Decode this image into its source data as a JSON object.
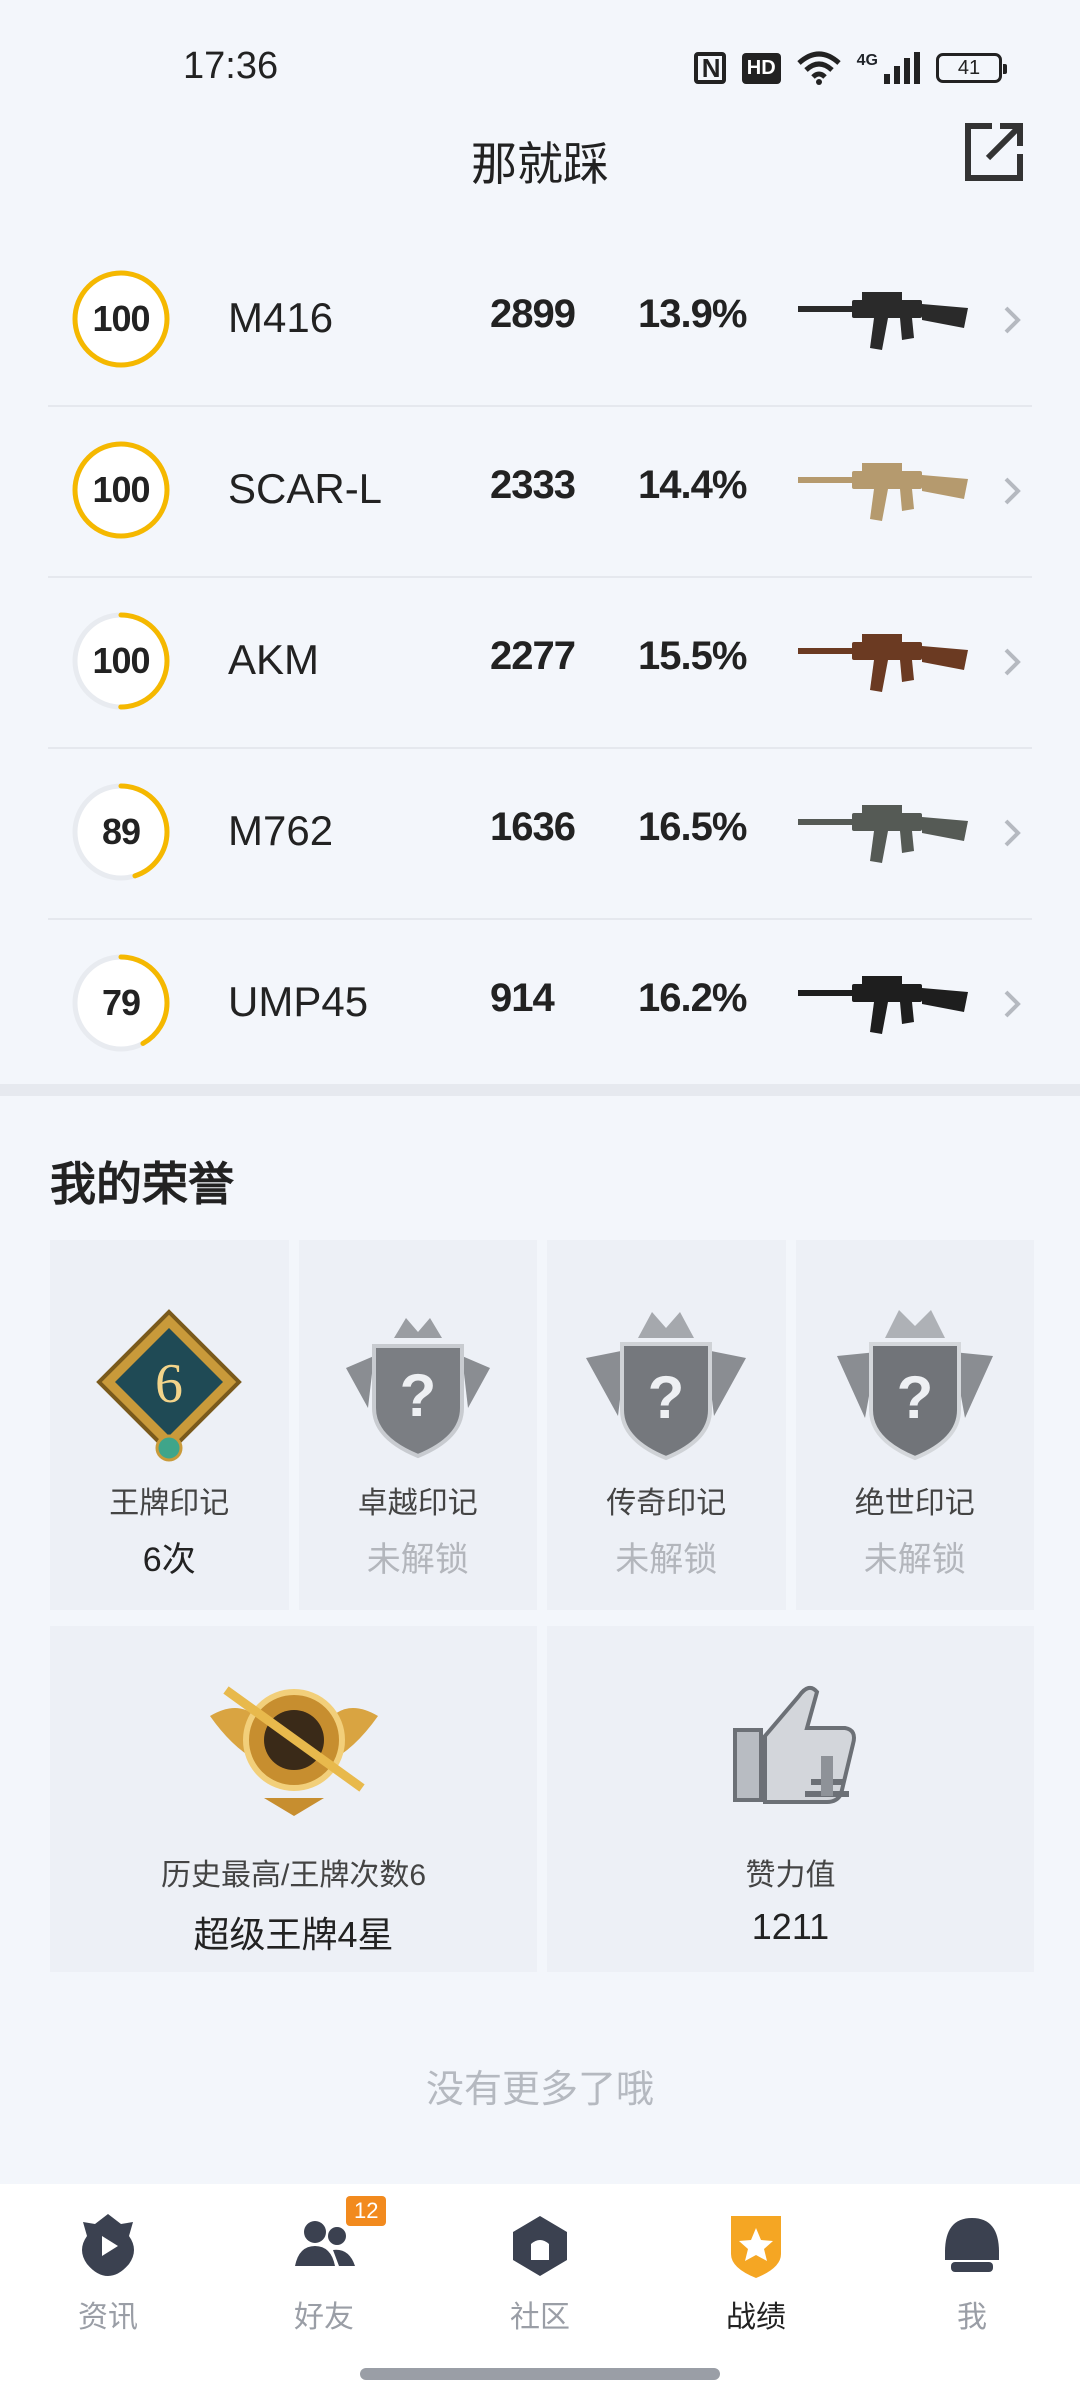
{
  "status_bar": {
    "time": "17:36",
    "hd_label": "HD",
    "network": "4G",
    "battery": "41"
  },
  "header": {
    "title": "那就踩"
  },
  "weapons": [
    {
      "score": "100",
      "progress": 1.0,
      "name": "M416",
      "kills": "2899",
      "rate": "13.9%",
      "gun_color": "#2a2a2a"
    },
    {
      "score": "100",
      "progress": 1.0,
      "name": "SCAR-L",
      "kills": "2333",
      "rate": "14.4%",
      "gun_color": "#b59a6e"
    },
    {
      "score": "100",
      "progress": 0.5,
      "name": "AKM",
      "kills": "2277",
      "rate": "15.5%",
      "gun_color": "#6b3a22"
    },
    {
      "score": "89",
      "progress": 0.45,
      "name": "M762",
      "kills": "1636",
      "rate": "16.5%",
      "gun_color": "#555a55"
    },
    {
      "score": "79",
      "progress": 0.42,
      "name": "UMP45",
      "kills": "914",
      "rate": "16.2%",
      "gun_color": "#1e1e1e"
    }
  ],
  "honor": {
    "title": "我的荣誉",
    "cards": [
      {
        "label": "王牌印记",
        "value": "6次",
        "locked": false,
        "badge_number": "6"
      },
      {
        "label": "卓越印记",
        "value": "未解锁",
        "locked": true
      },
      {
        "label": "传奇印记",
        "value": "未解锁",
        "locked": true
      },
      {
        "label": "绝世印记",
        "value": "未解锁",
        "locked": true
      }
    ],
    "rank": {
      "label": "历史最高/王牌次数6",
      "value": "超级王牌4星"
    },
    "likes": {
      "label": "赞力值",
      "value": "1211"
    }
  },
  "footer_text": "没有更多了哦",
  "nav": {
    "items": [
      {
        "label": "资讯",
        "icon": "news-icon"
      },
      {
        "label": "好友",
        "icon": "friends-icon",
        "badge": "12"
      },
      {
        "label": "社区",
        "icon": "community-icon"
      },
      {
        "label": "战绩",
        "icon": "record-icon",
        "active": true
      },
      {
        "label": "我",
        "icon": "profile-icon"
      }
    ]
  },
  "colors": {
    "ring_accent": "#f5b800",
    "ring_track": "#e8ebf0",
    "nav_active": "#f5a623",
    "badge_orange": "#f28a1e"
  }
}
